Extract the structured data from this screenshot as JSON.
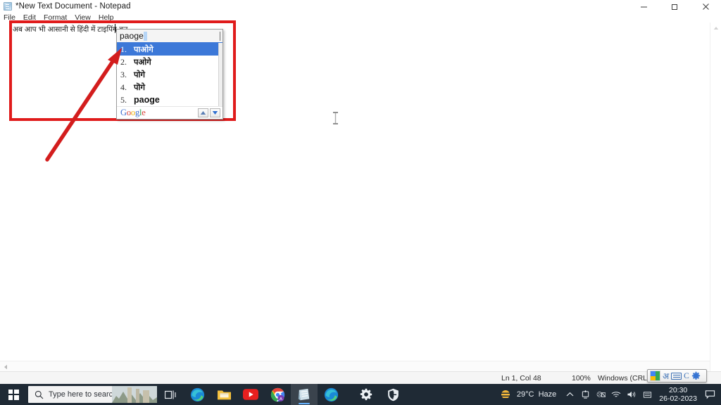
{
  "window": {
    "title": "*New Text Document - Notepad",
    "icon": "notepad-icon",
    "controls": {
      "minimize": "–",
      "maximize": "❐",
      "close": "✕"
    },
    "menu": [
      "File",
      "Edit",
      "Format",
      "View",
      "Help"
    ]
  },
  "document": {
    "text": "अब आप भी आसानी से हिंदी में टाइपिंग कर"
  },
  "ime_popup": {
    "input_value": "paoge",
    "suggestions": [
      {
        "num": "1.",
        "word": "पाओगे",
        "script": "devanagari",
        "selected": true
      },
      {
        "num": "2.",
        "word": "पओगे",
        "script": "devanagari",
        "selected": false
      },
      {
        "num": "3.",
        "word": "पोगे",
        "script": "devanagari",
        "selected": false
      },
      {
        "num": "4.",
        "word": "पॊगे",
        "script": "devanagari",
        "selected": false
      },
      {
        "num": "5.",
        "word": "paoge",
        "script": "latin",
        "selected": false
      }
    ],
    "brand": "Google",
    "brand_letters": [
      {
        "ch": "G",
        "color": "#3c6fd0"
      },
      {
        "ch": "o",
        "color": "#d9453b"
      },
      {
        "ch": "o",
        "color": "#efb20a"
      },
      {
        "ch": "g",
        "color": "#3c6fd0"
      },
      {
        "ch": "l",
        "color": "#2e9e4f"
      },
      {
        "ch": "e",
        "color": "#d9453b"
      }
    ],
    "nav_up": "▲",
    "nav_down": "▼"
  },
  "ime_toolbar": {
    "logo": "google-input-tools-icon",
    "language_char": "अ",
    "keyboard": "keyboard-icon",
    "mode_char": "C",
    "settings": "gear-icon"
  },
  "statusbar": {
    "position": "Ln 1, Col 48",
    "zoom": "100%",
    "line_ending": "Windows (CRLF)"
  },
  "annotation": {
    "box_color": "#e01b1b",
    "arrow_color": "#d31d1d"
  },
  "taskbar": {
    "start": "windows-start-icon",
    "search_placeholder": "Type here to search",
    "apps": [
      {
        "name": "task-view",
        "label": "Task View"
      },
      {
        "name": "microsoft-edge",
        "label": "Microsoft Edge"
      },
      {
        "name": "file-explorer",
        "label": "File Explorer"
      },
      {
        "name": "youtube",
        "label": "YouTube"
      },
      {
        "name": "google-chrome",
        "label": "Google Chrome"
      },
      {
        "name": "notepad",
        "label": "Notepad"
      },
      {
        "name": "microsoft-edge-2",
        "label": "Microsoft Edge"
      },
      {
        "name": "settings",
        "label": "Settings"
      },
      {
        "name": "windows-security",
        "label": "Windows Security"
      }
    ],
    "weather": {
      "temp": "29°C",
      "condition": "Haze",
      "icon": "sun-haze-icon"
    },
    "tray_icons": [
      "chevron-up-icon",
      "onedrive-icon",
      "network-icon",
      "wifi-icon",
      "volume-icon",
      "keyboard-tray-icon"
    ],
    "clock": {
      "time": "20:30",
      "date": "26-02-2023"
    },
    "notifications": "notification-icon"
  }
}
